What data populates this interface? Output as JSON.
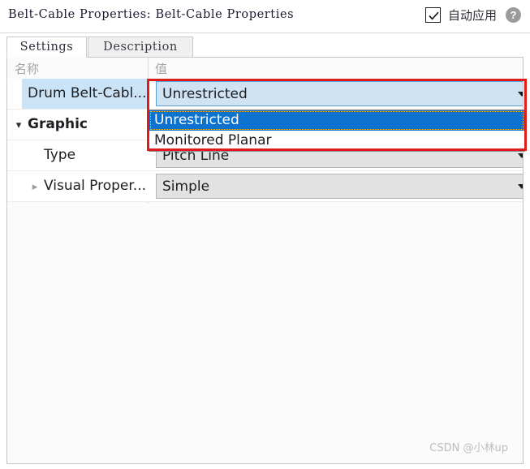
{
  "window": {
    "title": "Belt-Cable Properties: Belt-Cable Properties",
    "auto_apply_label": "自动应用",
    "auto_apply_checked": "✓",
    "help_icon_glyph": "?"
  },
  "tabs": [
    {
      "label": "Settings",
      "active": true
    },
    {
      "label": "Description",
      "active": false
    }
  ],
  "grid": {
    "headers": {
      "name": "名称",
      "value": "值"
    },
    "rows": [
      {
        "name": "Drum Belt-Cabl...",
        "value": "Unrestricted",
        "level": 0,
        "selected": true,
        "chevron": "none",
        "combo_style": "lightblue"
      },
      {
        "name": "Graphic",
        "value": "",
        "level": 1,
        "selected": false,
        "chevron": "down",
        "combo_style": "none"
      },
      {
        "name": "Type",
        "value": "Pitch Line",
        "level": 2,
        "selected": false,
        "chevron": "none",
        "combo_style": "gray"
      },
      {
        "name": "Visual Proper...",
        "value": "Simple",
        "level": 3,
        "selected": false,
        "chevron": "right",
        "combo_style": "gray"
      }
    ]
  },
  "dropdown": {
    "open": true,
    "selected_value": "Unrestricted",
    "options": [
      {
        "label": "Unrestricted",
        "highlighted": true
      },
      {
        "label": "Monitored Planar",
        "highlighted": false
      }
    ]
  },
  "watermark": {
    "text": "CSDN @小林up"
  },
  "colors": {
    "selection_blue": "#0b72cf",
    "row_select_blue": "#cbe3f7",
    "combo_blue": "#cfe3f5",
    "combo_gray": "#e2e2e2",
    "annotation_red": "#e01b1b"
  }
}
